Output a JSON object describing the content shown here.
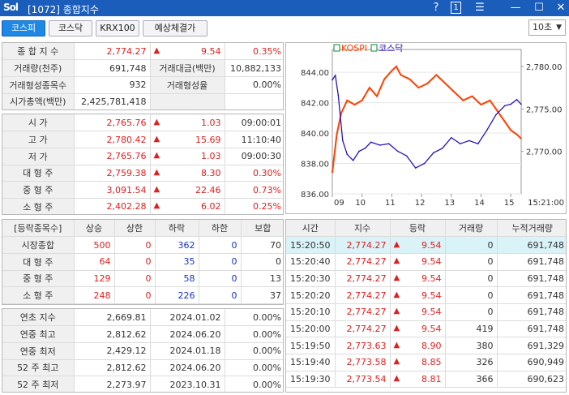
{
  "window": {
    "logo": "Sol",
    "title": "[1072] 종합지수",
    "help": "?",
    "page": "1"
  },
  "tabs": [
    "코스피",
    "코스닥",
    "KRX100",
    "예상체결가"
  ],
  "interval": "10초",
  "summary": {
    "rows": [
      {
        "label": "종 합 지 수",
        "value": "2,774.27",
        "arrow": "▲",
        "change": "9.54",
        "rate": "0.35%"
      },
      {
        "label": "거래량(천주)",
        "value": "691,748",
        "label2": "거래대금(백만)",
        "value2": "10,882,133"
      },
      {
        "label": "거래형성종목수",
        "value": "932",
        "label2": "거래형성율",
        "value2": "0.00%"
      },
      {
        "label": "시가총액(백만)",
        "value": "2,425,781,418",
        "label2": "",
        "value2": ""
      }
    ]
  },
  "prices": [
    {
      "label": "시     가",
      "value": "2,765.76",
      "arrow": "▲",
      "change": "1.03",
      "extra": "09:00:01"
    },
    {
      "label": "고     가",
      "value": "2,780.42",
      "arrow": "▲",
      "change": "15.69",
      "extra": "11:10:40"
    },
    {
      "label": "저     가",
      "value": "2,765.76",
      "arrow": "▲",
      "change": "1.03",
      "extra": "09:00:30"
    },
    {
      "label": "대 형 주",
      "value": "2,759.38",
      "arrow": "▲",
      "change": "8.30",
      "extra": "0.30%"
    },
    {
      "label": "중 형 주",
      "value": "3,091.54",
      "arrow": "▲",
      "change": "22.46",
      "extra": "0.73%"
    },
    {
      "label": "소 형 주",
      "value": "2,402.28",
      "arrow": "▲",
      "change": "6.02",
      "extra": "0.25%"
    }
  ],
  "updown": {
    "headers": [
      "[등락종목수]",
      "상승",
      "상한",
      "하락",
      "하한",
      "보합"
    ],
    "rows": [
      {
        "label": "시장종합",
        "up": "500",
        "uplimit": "0",
        "down": "362",
        "downlimit": "0",
        "flat": "70"
      },
      {
        "label": "대 형 주",
        "up": "64",
        "uplimit": "0",
        "down": "35",
        "downlimit": "0",
        "flat": "0"
      },
      {
        "label": "중 형 주",
        "up": "129",
        "uplimit": "0",
        "down": "58",
        "downlimit": "0",
        "flat": "13"
      },
      {
        "label": "소 형 주",
        "up": "248",
        "uplimit": "0",
        "down": "226",
        "downlimit": "0",
        "flat": "37"
      }
    ]
  },
  "history": [
    {
      "label": "연초  지수",
      "value": "2,669.81",
      "date": "2024.01.02",
      "rate": "0.00%"
    },
    {
      "label": "연중  최고",
      "value": "2,812.62",
      "date": "2024.06.20",
      "rate": "0.00%"
    },
    {
      "label": "연중  최저",
      "value": "2,429.12",
      "date": "2024.01.18",
      "rate": "0.00%"
    },
    {
      "label": "52 주 최고",
      "value": "2,812.62",
      "date": "2024.06.20",
      "rate": "0.00%"
    },
    {
      "label": "52 주 최저",
      "value": "2,273.97",
      "date": "2023.10.31",
      "rate": "0.00%"
    }
  ],
  "ticks": {
    "headers": [
      "시간",
      "지수",
      "등락",
      "거래량",
      "누적거래량"
    ],
    "rows": [
      {
        "time": "15:20:50",
        "index": "2,774.27",
        "arrow": "▲",
        "change": "9.54",
        "vol": "0",
        "cum": "691,748"
      },
      {
        "time": "15:20:40",
        "index": "2,774.27",
        "arrow": "▲",
        "change": "9.54",
        "vol": "0",
        "cum": "691,748"
      },
      {
        "time": "15:20:30",
        "index": "2,774.27",
        "arrow": "▲",
        "change": "9.54",
        "vol": "0",
        "cum": "691,748"
      },
      {
        "time": "15:20:20",
        "index": "2,774.27",
        "arrow": "▲",
        "change": "9.54",
        "vol": "0",
        "cum": "691,748"
      },
      {
        "time": "15:20:10",
        "index": "2,774.27",
        "arrow": "▲",
        "change": "9.54",
        "vol": "0",
        "cum": "691,748"
      },
      {
        "time": "15:20:00",
        "index": "2,774.27",
        "arrow": "▲",
        "change": "9.54",
        "vol": "419",
        "cum": "691,748"
      },
      {
        "time": "15:19:50",
        "index": "2,773.63",
        "arrow": "▲",
        "change": "8.90",
        "vol": "380",
        "cum": "691,329"
      },
      {
        "time": "15:19:40",
        "index": "2,773.58",
        "arrow": "▲",
        "change": "8.85",
        "vol": "326",
        "cum": "690,949"
      },
      {
        "time": "15:19:30",
        "index": "2,773.54",
        "arrow": "▲",
        "change": "8.81",
        "vol": "366",
        "cum": "690,623"
      }
    ]
  },
  "chart_data": {
    "type": "line",
    "legend": [
      "KOSPI",
      "코스닥"
    ],
    "colors": {
      "KOSPI": "#ff4000",
      "코스닥": "#2a10b8"
    },
    "x_ticks": [
      "09",
      "10",
      "11",
      "12",
      "13",
      "14",
      "15"
    ],
    "x_end_label": "15:21:00",
    "left_axis": {
      "ticks": [
        "844.00",
        "842.00",
        "840.00",
        "838.00",
        "836.00"
      ],
      "ylim": [
        836,
        845.5
      ]
    },
    "right_axis": {
      "ticks": [
        "2,780.00",
        "2,775.00",
        "2,770.00"
      ],
      "ylim": [
        2765,
        2782
      ]
    },
    "series": [
      {
        "name": "KOSPI",
        "axis": "right",
        "x": [
          9.0,
          9.15,
          9.3,
          9.5,
          9.75,
          10.0,
          10.25,
          10.5,
          10.75,
          11.0,
          11.15,
          11.3,
          11.6,
          11.9,
          12.2,
          12.5,
          12.8,
          13.1,
          13.4,
          13.7,
          14.0,
          14.3,
          14.6,
          14.8,
          15.0,
          15.2,
          15.35
        ],
        "y": [
          2767.5,
          2772.0,
          2774.5,
          2776.0,
          2775.5,
          2776.0,
          2777.5,
          2776.5,
          2778.5,
          2779.5,
          2780.0,
          2779.0,
          2778.5,
          2777.5,
          2778.0,
          2779.0,
          2778.0,
          2777.0,
          2776.0,
          2776.5,
          2775.5,
          2776.0,
          2774.5,
          2773.5,
          2772.5,
          2772.0,
          2771.5
        ]
      },
      {
        "name": "코스닥",
        "axis": "left",
        "x": [
          9.0,
          9.1,
          9.2,
          9.35,
          9.5,
          9.7,
          9.9,
          10.1,
          10.3,
          10.6,
          10.9,
          11.2,
          11.5,
          11.8,
          12.1,
          12.4,
          12.7,
          13.0,
          13.3,
          13.6,
          13.9,
          14.2,
          14.5,
          14.8,
          15.0,
          15.2,
          15.35
        ],
        "y": [
          843.5,
          843.8,
          842.5,
          839.5,
          838.6,
          838.2,
          838.8,
          839.0,
          839.4,
          839.2,
          839.3,
          838.8,
          838.5,
          837.7,
          838.0,
          838.7,
          839.0,
          839.7,
          839.3,
          839.5,
          839.3,
          840.2,
          841.2,
          841.8,
          841.9,
          842.2,
          841.9
        ]
      }
    ]
  }
}
